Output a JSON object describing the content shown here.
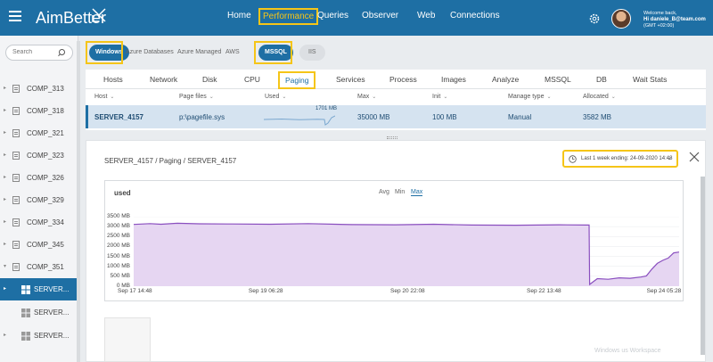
{
  "header": {
    "logo": "AimBetter",
    "nav": [
      {
        "label": "Home",
        "active": false
      },
      {
        "label": "Performance",
        "active": true
      },
      {
        "label": "Queries",
        "active": false
      },
      {
        "label": "Observer",
        "active": false
      },
      {
        "label": "Web",
        "active": false
      },
      {
        "label": "Connections",
        "active": false
      }
    ],
    "welcome_line": "Welcome back,",
    "user": "Hi daniele_B@team.com",
    "tz": "(GMT +02:00)"
  },
  "sidebar": {
    "search_placeholder": "Search",
    "items": [
      {
        "label": "COMP_313"
      },
      {
        "label": "COMP_318"
      },
      {
        "label": "COMP_321"
      },
      {
        "label": "COMP_323"
      },
      {
        "label": "COMP_326"
      },
      {
        "label": "COMP_329"
      },
      {
        "label": "COMP_334"
      },
      {
        "label": "COMP_345"
      },
      {
        "label": "COMP_351"
      },
      {
        "label": "SERVER..."
      },
      {
        "label": "SERVER..."
      },
      {
        "label": "SERVER..."
      }
    ]
  },
  "filters": {
    "platforms": [
      "Windows",
      "Azure Databases",
      "Azure Managed",
      "AWS"
    ],
    "engines": [
      "MSSQL",
      "IIS"
    ]
  },
  "tabs": [
    "Hosts",
    "Network",
    "Disk",
    "CPU",
    "Paging",
    "Services",
    "Process",
    "Images",
    "Analyze",
    "MSSQL",
    "DB",
    "Wait Stats"
  ],
  "table": {
    "columns": [
      "Host",
      "Page files",
      "Used",
      "Max",
      "Init",
      "Manage type",
      "Allocated"
    ],
    "row": {
      "host": "SERVER_4157",
      "page_files": "p:\\pagefile.sys",
      "used": "1701 MB",
      "max": "35000 MB",
      "init": "100 MB",
      "manage_type": "Manual",
      "allocated": "3582 MB"
    }
  },
  "detail": {
    "breadcrumb": "SERVER_4157 / Paging / SERVER_4157",
    "range": "Last 1 week ending: 24-09-2020 14:48",
    "watermark": "Windows us Workspace"
  },
  "chart_data": {
    "type": "area",
    "title": "used",
    "legend_tabs": [
      "Avg",
      "Min",
      "Max"
    ],
    "active_tab": "Max",
    "y_ticks": [
      "3500 MB",
      "3000 MB",
      "2500 MB",
      "2000 MB",
      "1500 MB",
      "1000 MB",
      "500 MB",
      "0 MB"
    ],
    "ylim": [
      0,
      3500
    ],
    "x_ticks": [
      "Sep 17 14:48",
      "Sep 19 06:28",
      "Sep 20 22:08",
      "Sep 22 13:48",
      "Sep 24 05:28"
    ],
    "x_tick_pos": [
      0.0,
      0.24,
      0.5,
      0.75,
      0.97
    ],
    "series": [
      {
        "color": "#8a4fbf",
        "fill": "#e6d6f2",
        "points": [
          [
            0.0,
            3110
          ],
          [
            0.03,
            3150
          ],
          [
            0.05,
            3120
          ],
          [
            0.08,
            3170
          ],
          [
            0.12,
            3140
          ],
          [
            0.18,
            3130
          ],
          [
            0.25,
            3120
          ],
          [
            0.32,
            3150
          ],
          [
            0.4,
            3100
          ],
          [
            0.48,
            3090
          ],
          [
            0.55,
            3120
          ],
          [
            0.62,
            3080
          ],
          [
            0.7,
            3070
          ],
          [
            0.78,
            3090
          ],
          [
            0.83,
            3080
          ],
          [
            0.835,
            3080
          ],
          [
            0.836,
            90
          ],
          [
            0.85,
            380
          ],
          [
            0.87,
            350
          ],
          [
            0.89,
            420
          ],
          [
            0.91,
            400
          ],
          [
            0.93,
            460
          ],
          [
            0.94,
            520
          ],
          [
            0.95,
            860
          ],
          [
            0.96,
            1150
          ],
          [
            0.97,
            1300
          ],
          [
            0.98,
            1420
          ],
          [
            0.99,
            1680
          ],
          [
            1.0,
            1720
          ]
        ]
      }
    ]
  }
}
